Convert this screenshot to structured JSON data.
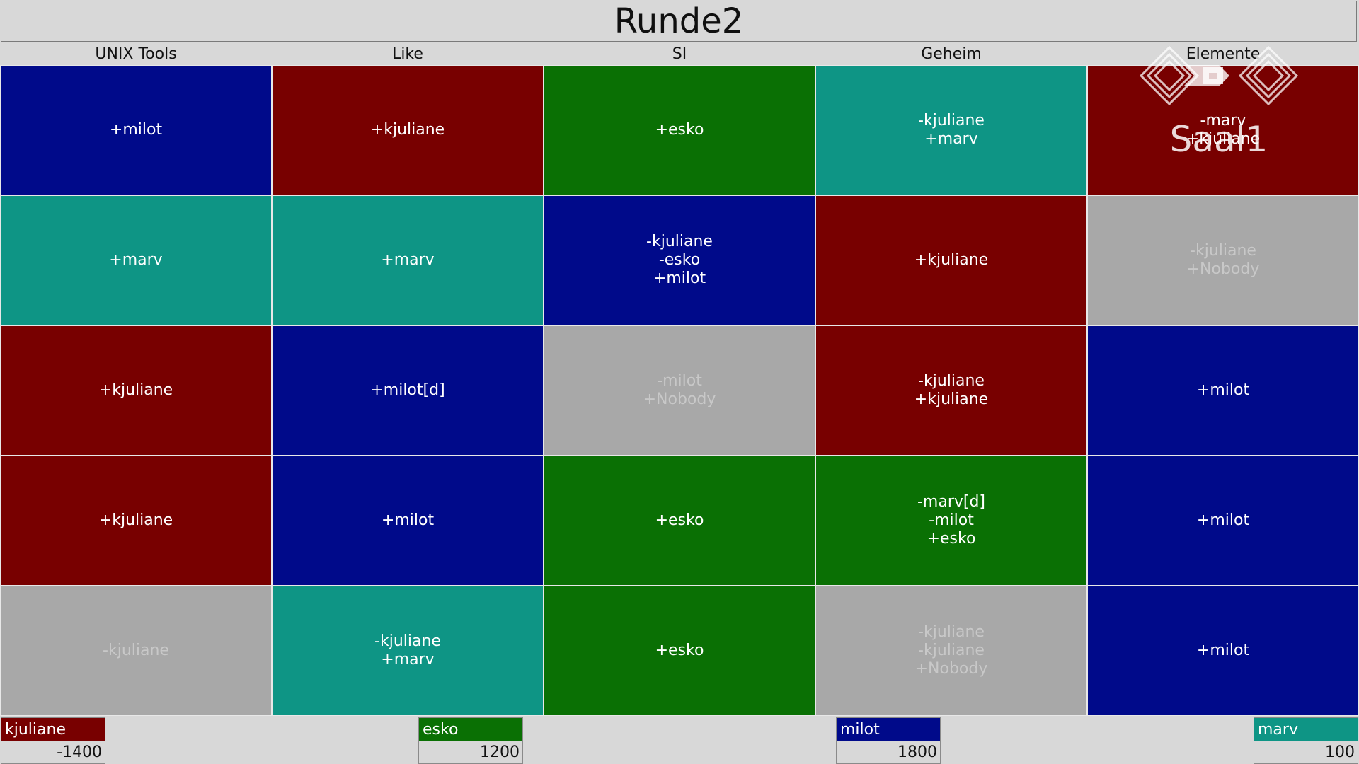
{
  "round_title": "Runde2",
  "watermark": {
    "text": "Saal1",
    "icon": "gpn-logo-icon"
  },
  "colors": {
    "blue": "#000a8a",
    "red": "#780000",
    "green": "#0a7004",
    "teal": "#0e9585",
    "grey": "#a8a8a8"
  },
  "categories": [
    "UNIX Tools",
    "Like",
    "SI",
    "Geheim",
    "Elemente"
  ],
  "rows": [
    [
      {
        "color": "blue",
        "lines": [
          "+milot"
        ]
      },
      {
        "color": "red",
        "lines": [
          "+kjuliane"
        ]
      },
      {
        "color": "green",
        "lines": [
          "+esko"
        ]
      },
      {
        "color": "teal",
        "lines": [
          "-kjuliane",
          "+marv"
        ]
      },
      {
        "color": "red",
        "lines": [
          "-marv",
          "+kjuliane"
        ]
      }
    ],
    [
      {
        "color": "teal",
        "lines": [
          "+marv"
        ]
      },
      {
        "color": "teal",
        "lines": [
          "+marv"
        ]
      },
      {
        "color": "blue",
        "lines": [
          "-kjuliane",
          "-esko",
          "+milot"
        ]
      },
      {
        "color": "red",
        "lines": [
          "+kjuliane"
        ]
      },
      {
        "color": "grey",
        "lines": [
          "-kjuliane",
          "+Nobody"
        ]
      }
    ],
    [
      {
        "color": "red",
        "lines": [
          "+kjuliane"
        ]
      },
      {
        "color": "blue",
        "lines": [
          "+milot[d]"
        ]
      },
      {
        "color": "grey",
        "lines": [
          "-milot",
          "+Nobody"
        ]
      },
      {
        "color": "red",
        "lines": [
          "-kjuliane",
          "+kjuliane"
        ]
      },
      {
        "color": "blue",
        "lines": [
          "+milot"
        ]
      }
    ],
    [
      {
        "color": "red",
        "lines": [
          "+kjuliane"
        ]
      },
      {
        "color": "blue",
        "lines": [
          "+milot"
        ]
      },
      {
        "color": "green",
        "lines": [
          "+esko"
        ]
      },
      {
        "color": "green",
        "lines": [
          "-marv[d]",
          "-milot",
          "+esko"
        ]
      },
      {
        "color": "blue",
        "lines": [
          "+milot"
        ]
      }
    ],
    [
      {
        "color": "grey",
        "lines": [
          "-kjuliane"
        ]
      },
      {
        "color": "teal",
        "lines": [
          "-kjuliane",
          "+marv"
        ]
      },
      {
        "color": "green",
        "lines": [
          "+esko"
        ]
      },
      {
        "color": "grey",
        "lines": [
          "-kjuliane",
          "-kjuliane",
          "+Nobody"
        ]
      },
      {
        "color": "blue",
        "lines": [
          "+milot"
        ]
      }
    ]
  ],
  "players": [
    {
      "name": "kjuliane",
      "score": "-1400",
      "color": "red"
    },
    {
      "name": "esko",
      "score": "1200",
      "color": "green"
    },
    {
      "name": "milot",
      "score": "1800",
      "color": "blue"
    },
    {
      "name": "marv",
      "score": "100",
      "color": "teal"
    }
  ]
}
